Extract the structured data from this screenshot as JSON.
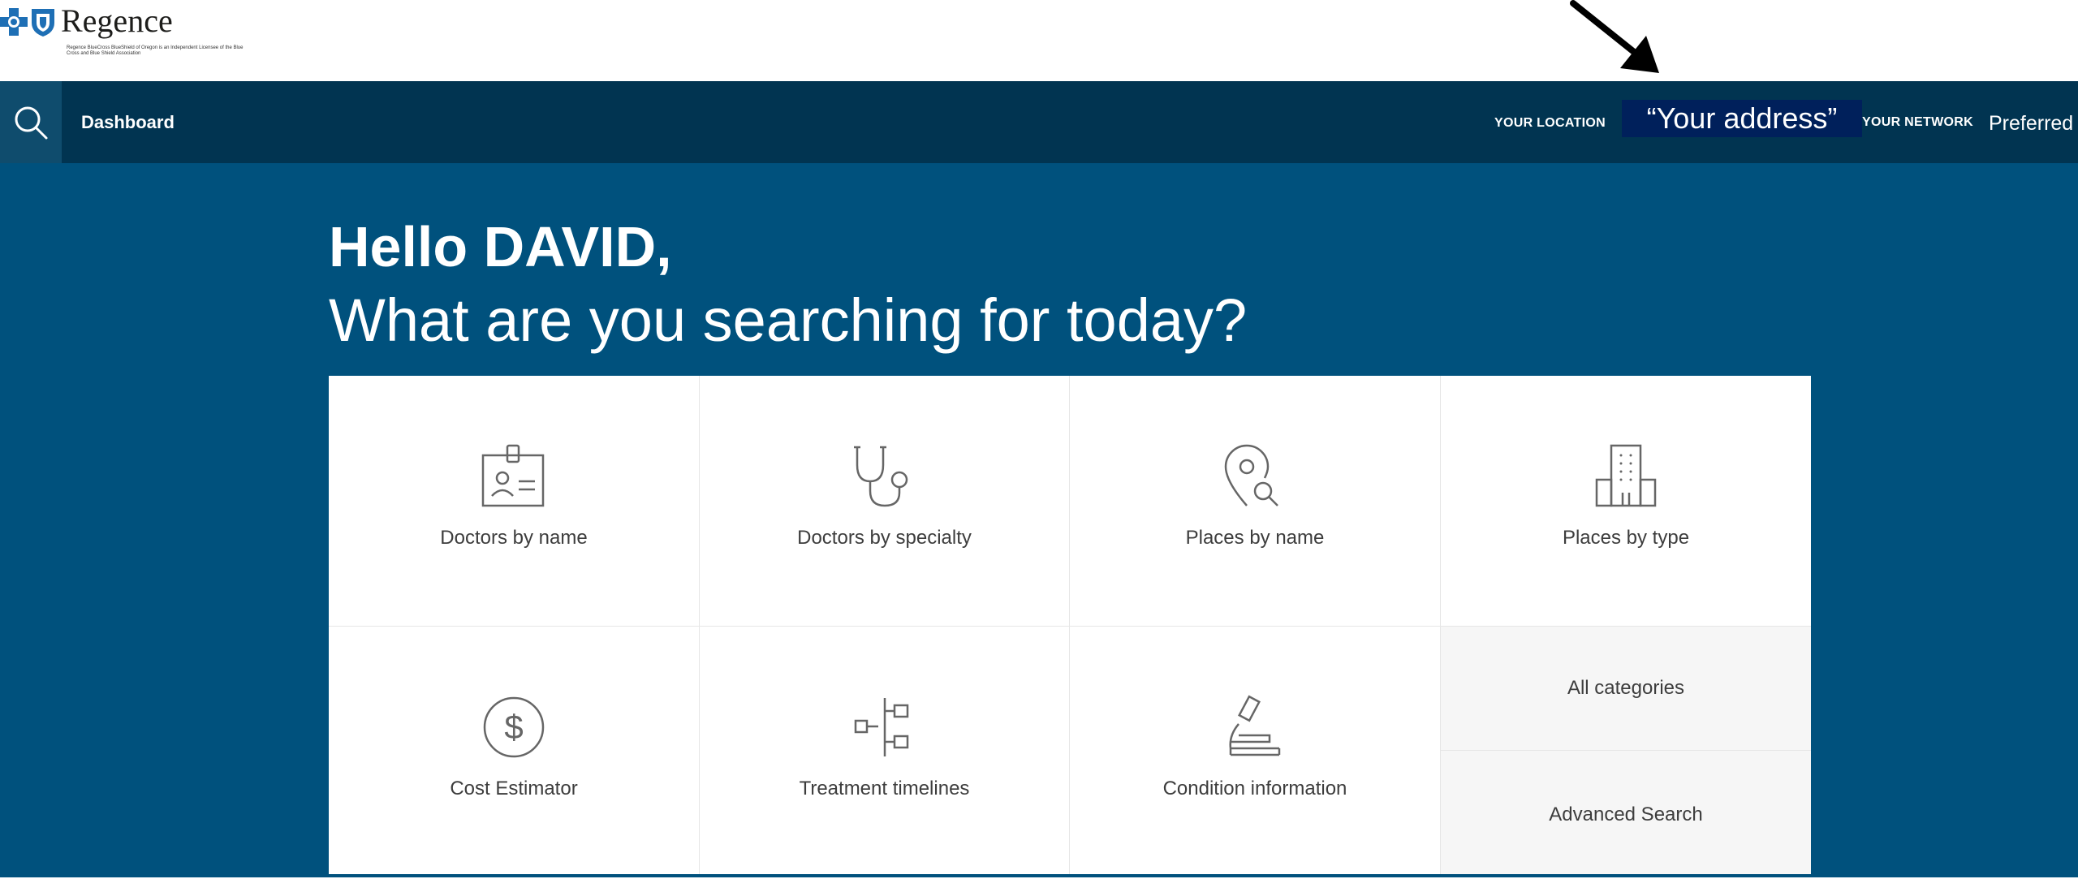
{
  "logo": {
    "name": "Regence",
    "tagline": "Regence BlueCross BlueShield of Oregon is an Independent Licensee of the Blue Cross and Blue Shield Association"
  },
  "nav": {
    "dashboard": "Dashboard",
    "location_label": "YOUR LOCATION",
    "location_value": "“Your address”",
    "network_label": "YOUR NETWORK",
    "network_value": "Preferred"
  },
  "hero": {
    "greeting": "Hello DAVID,",
    "subhead": "What are you searching for today?"
  },
  "cards": {
    "doctors_by_name": "Doctors by name",
    "doctors_by_specialty": "Doctors by specialty",
    "places_by_name": "Places by name",
    "places_by_type": "Places by type",
    "cost_estimator": "Cost Estimator",
    "treatment_timelines": "Treatment timelines",
    "condition_information": "Condition information",
    "all_categories": "All categories",
    "advanced_search": "Advanced Search"
  },
  "colors": {
    "nav_bg": "#013451",
    "hero_bg": "#00517d",
    "address_bg": "#00205b",
    "card_bg": "#ffffff",
    "side_bg": "#f6f6f6"
  }
}
